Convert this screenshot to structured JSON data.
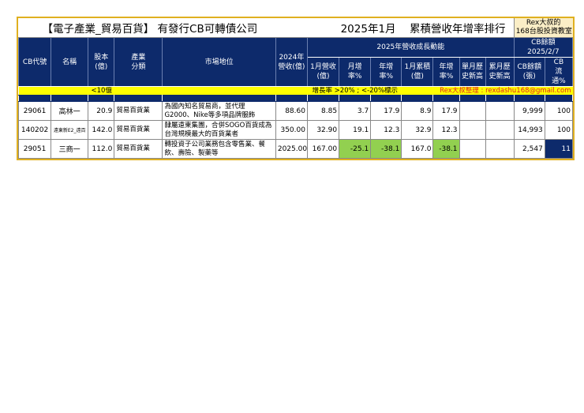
{
  "title": {
    "main": "【電子產業_貿易百貨】 有發行CB可轉債公司",
    "period": "2025年1月",
    "sub": "累積營收年增率排行",
    "rex_line1": "Rex大叔的",
    "rex_line2": "168台股投資教室"
  },
  "headers": {
    "code": "CB代號",
    "name": "名稱",
    "capital": "股本(億)",
    "industry": "產業分類",
    "position": "市場地位",
    "rev2024": "2024年營收(億)",
    "growth_group": "2025年營收成長動能",
    "cb_group1": "CB餘額",
    "cb_group2": "2025/2/7",
    "m_rev": "1月營收(億)",
    "mom": "月增率%",
    "yoy": "年增率%",
    "cum": "1月累積(億)",
    "cum_yoy": "年增率%",
    "m_high": "單月歷史新高",
    "c_high": "累月歷史新高",
    "cb_bal": "CB餘額(張)",
    "cb_float": "CB流通%"
  },
  "notes": {
    "cap": "<10億",
    "rule": "增長率 >20% ; <-20%標示",
    "author": "Rex大叔整理 : rexdashu168@gmail.com"
  },
  "rows": [
    {
      "code": "29061",
      "name": "高林一",
      "capital": "20.9",
      "industry": "貿易百貨業",
      "position": "為國內知名貿易商，並代理G2000、Nike等多項品牌服飾",
      "rev2024": "88.60",
      "m_rev": "8.85",
      "mom": "3.7",
      "yoy": "17.9",
      "cum": "8.9",
      "cum_yoy": "17.9",
      "m_high": "",
      "c_high": "",
      "cb_bal": "9,999",
      "cb_float": "100"
    },
    {
      "code": "140202",
      "name": "遠東新E2_遠百",
      "capital": "142.0",
      "industry": "貿易百貨業",
      "position": "隸屬遠東集團，合併SOGO百貨成為台灣規模最大的百貨業者",
      "rev2024": "350.00",
      "m_rev": "32.90",
      "mom": "19.1",
      "yoy": "12.3",
      "cum": "32.9",
      "cum_yoy": "12.3",
      "m_high": "",
      "c_high": "",
      "cb_bal": "14,993",
      "cb_float": "100"
    },
    {
      "code": "29051",
      "name": "三商一",
      "capital": "112.0",
      "industry": "貿易百貨業",
      "position": "轉投資子公司業務包含零售業、餐飲、壽險、製藥等",
      "rev2024": "2025.00",
      "m_rev": "167.00",
      "mom": "-25.1",
      "yoy": "-38.1",
      "cum": "167.0",
      "cum_yoy": "-38.1",
      "m_high": "",
      "c_high": "",
      "cb_bal": "2,547",
      "cb_float": "11"
    }
  ]
}
